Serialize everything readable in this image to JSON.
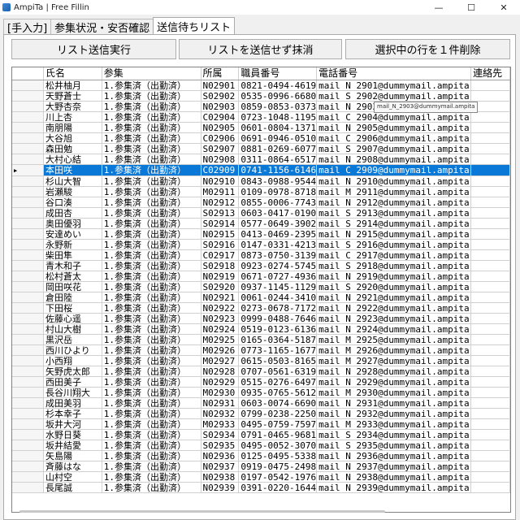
{
  "window": {
    "title": "AmpiTa | Free Fillin",
    "min": "—",
    "max": "☐",
    "close": "✕"
  },
  "tabs": [
    "[手入力]",
    "参集状況・安否確認",
    "送信待ちリスト"
  ],
  "buttons": {
    "send": "リスト送信実行",
    "clear": "リストを送信せず抹消",
    "delete_row": "選択中の行を１件削除"
  },
  "columns": [
    "氏名",
    "参集",
    "所属",
    "職員番号",
    "電話番号",
    "連絡先"
  ],
  "tooltip": "mail_N_2903@dummymail.ampita",
  "selected_row": 8,
  "rows": [
    [
      "松井柚月",
      "1.参集済（出勤済）",
      "N02901",
      "0821-0494-4619",
      "mail N 2901@dummymail.ampita"
    ],
    [
      "天野蒼士",
      "1.参集済（出勤済）",
      "S02902",
      "0535-0996-6680",
      "mail S 2902@dummymail.ampita"
    ],
    [
      "大野杏奈",
      "1.参集済（出勤済）",
      "N02903",
      "0859-0853-0373",
      "mail N 2903"
    ],
    [
      "川上杏",
      "1.参集済（出勤済）",
      "C02904",
      "0723-1048-1195",
      "mail C 2904@dummymail.ampita"
    ],
    [
      "南朋陽",
      "1.参集済（出勤済）",
      "N02905",
      "0601-0804-1371",
      "mail N 2905@dummymail.ampita"
    ],
    [
      "大谷旭",
      "1.参集済（出勤済）",
      "C02906",
      "0691-0946-0510",
      "mail C 2906@dummymail.ampita"
    ],
    [
      "森田勉",
      "1.参集済（出勤済）",
      "S02907",
      "0881-0269-6077",
      "mail S 2907@dummymail.ampita"
    ],
    [
      "大村心結",
      "1.参集済（出勤済）",
      "N02908",
      "0311-0864-6517",
      "mail N 2908@dummymail.ampita"
    ],
    [
      "本田咲",
      "1.参集済（出勤済）",
      "C02909",
      "0741-1156-6146",
      "mail C 2909@dummymail.ampita"
    ],
    [
      "杉山大智",
      "1.参集済（出勤済）",
      "N02910",
      "0843-0988-9544",
      "mail N 2910@dummymail.ampita"
    ],
    [
      "岩瀬駿",
      "1.参集済（出勤済）",
      "M02911",
      "0109-0978-8718",
      "mail M 2911@dummymail.ampita"
    ],
    [
      "谷口湊",
      "1.参集済（出勤済）",
      "N02912",
      "0855-0006-7743",
      "mail N 2912@dummymail.ampita"
    ],
    [
      "成田杏",
      "1.参集済（出勤済）",
      "S02913",
      "0603-0417-0190",
      "mail S 2913@dummymail.ampita"
    ],
    [
      "奥田優羽",
      "1.参集済（出勤済）",
      "S02914",
      "0577-0649-3902",
      "mail S 2914@dummymail.ampita"
    ],
    [
      "安達めい",
      "1.参集済（出勤済）",
      "N02915",
      "0413-0469-2395",
      "mail N 2915@dummymail.ampita"
    ],
    [
      "永野新",
      "1.参集済（出勤済）",
      "S02916",
      "0147-0331-4213",
      "mail S 2916@dummymail.ampita"
    ],
    [
      "柴田隼",
      "1.参集済（出勤済）",
      "C02917",
      "0873-0750-3139",
      "mail C 2917@dummymail.ampita"
    ],
    [
      "青木和子",
      "1.参集済（出勤済）",
      "S02918",
      "0923-0274-5745",
      "mail S 2918@dummymail.ampita"
    ],
    [
      "松村蒼太",
      "1.参集済（出勤済）",
      "N02919",
      "0671-0727-4936",
      "mail N 2919@dummymail.ampita"
    ],
    [
      "岡田咲花",
      "1.参集済（出勤済）",
      "S02920",
      "0937-1145-1129",
      "mail S 2920@dummymail.ampita"
    ],
    [
      "倉田陸",
      "1.参集済（出勤済）",
      "N02921",
      "0061-0244-3410",
      "mail N 2921@dummymail.ampita"
    ],
    [
      "下田桜",
      "1.参集済（出勤済）",
      "N02922",
      "0273-0678-7172",
      "mail N 2922@dummymail.ampita"
    ],
    [
      "佐藤心遥",
      "1.参集済（出勤済）",
      "N02923",
      "0999-0488-7646",
      "mail N 2923@dummymail.ampita"
    ],
    [
      "村山大樹",
      "1.参集済（出勤済）",
      "N02924",
      "0519-0123-6136",
      "mail N 2924@dummymail.ampita"
    ],
    [
      "黒沢岳",
      "1.参集済（出勤済）",
      "M02925",
      "0165-0364-5187",
      "mail M 2925@dummymail.ampita"
    ],
    [
      "西川ひより",
      "1.参集済（出勤済）",
      "M02926",
      "0773-1165-1677",
      "mail M 2926@dummymail.ampita"
    ],
    [
      "小西翔",
      "1.参集済（出勤済）",
      "M02927",
      "0615-0503-8165",
      "mail M 2927@dummymail.ampita"
    ],
    [
      "矢野虎太郎",
      "1.参集済（出勤済）",
      "N02928",
      "0707-0561-6319",
      "mail N 2928@dummymail.ampita"
    ],
    [
      "西田美子",
      "1.参集済（出勤済）",
      "N02929",
      "0515-0276-6497",
      "mail N 2929@dummymail.ampita"
    ],
    [
      "長谷川翔大",
      "1.参集済（出勤済）",
      "M02930",
      "0935-0765-5612",
      "mail M 2930@dummymail.ampita"
    ],
    [
      "成田美羽",
      "1.参集済（出勤済）",
      "N02931",
      "0603-0074-6690",
      "mail N 2931@dummymail.ampita"
    ],
    [
      "杉本幸子",
      "1.参集済（出勤済）",
      "N02932",
      "0799-0238-2250",
      "mail N 2932@dummymail.ampita"
    ],
    [
      "坂井大河",
      "1.参集済（出勤済）",
      "M02933",
      "0495-0759-7597",
      "mail M 2933@dummymail.ampita"
    ],
    [
      "水野日葵",
      "1.参集済（出勤済）",
      "S02934",
      "0791-0465-9681",
      "mail S 2934@dummymail.ampita"
    ],
    [
      "坂井結愛",
      "1.参集済（出勤済）",
      "S02935",
      "0495-0052-3070",
      "mail S 2935@dummymail.ampita"
    ],
    [
      "矢島陽",
      "1.参集済（出勤済）",
      "N02936",
      "0125-0495-5338",
      "mail N 2936@dummymail.ampita"
    ],
    [
      "斉藤はな",
      "1.参集済（出勤済）",
      "N02937",
      "0919-0475-2498",
      "mail N 2937@dummymail.ampita"
    ],
    [
      "山村空",
      "1.参集済（出勤済）",
      "N02938",
      "0197-0542-1976",
      "mail N 2938@dummymail.ampita"
    ],
    [
      "長尾誠",
      "1.参集済（出勤済）",
      "N02939",
      "0391-0220-1644",
      "mail N 2939@dummymail.ampita"
    ]
  ]
}
